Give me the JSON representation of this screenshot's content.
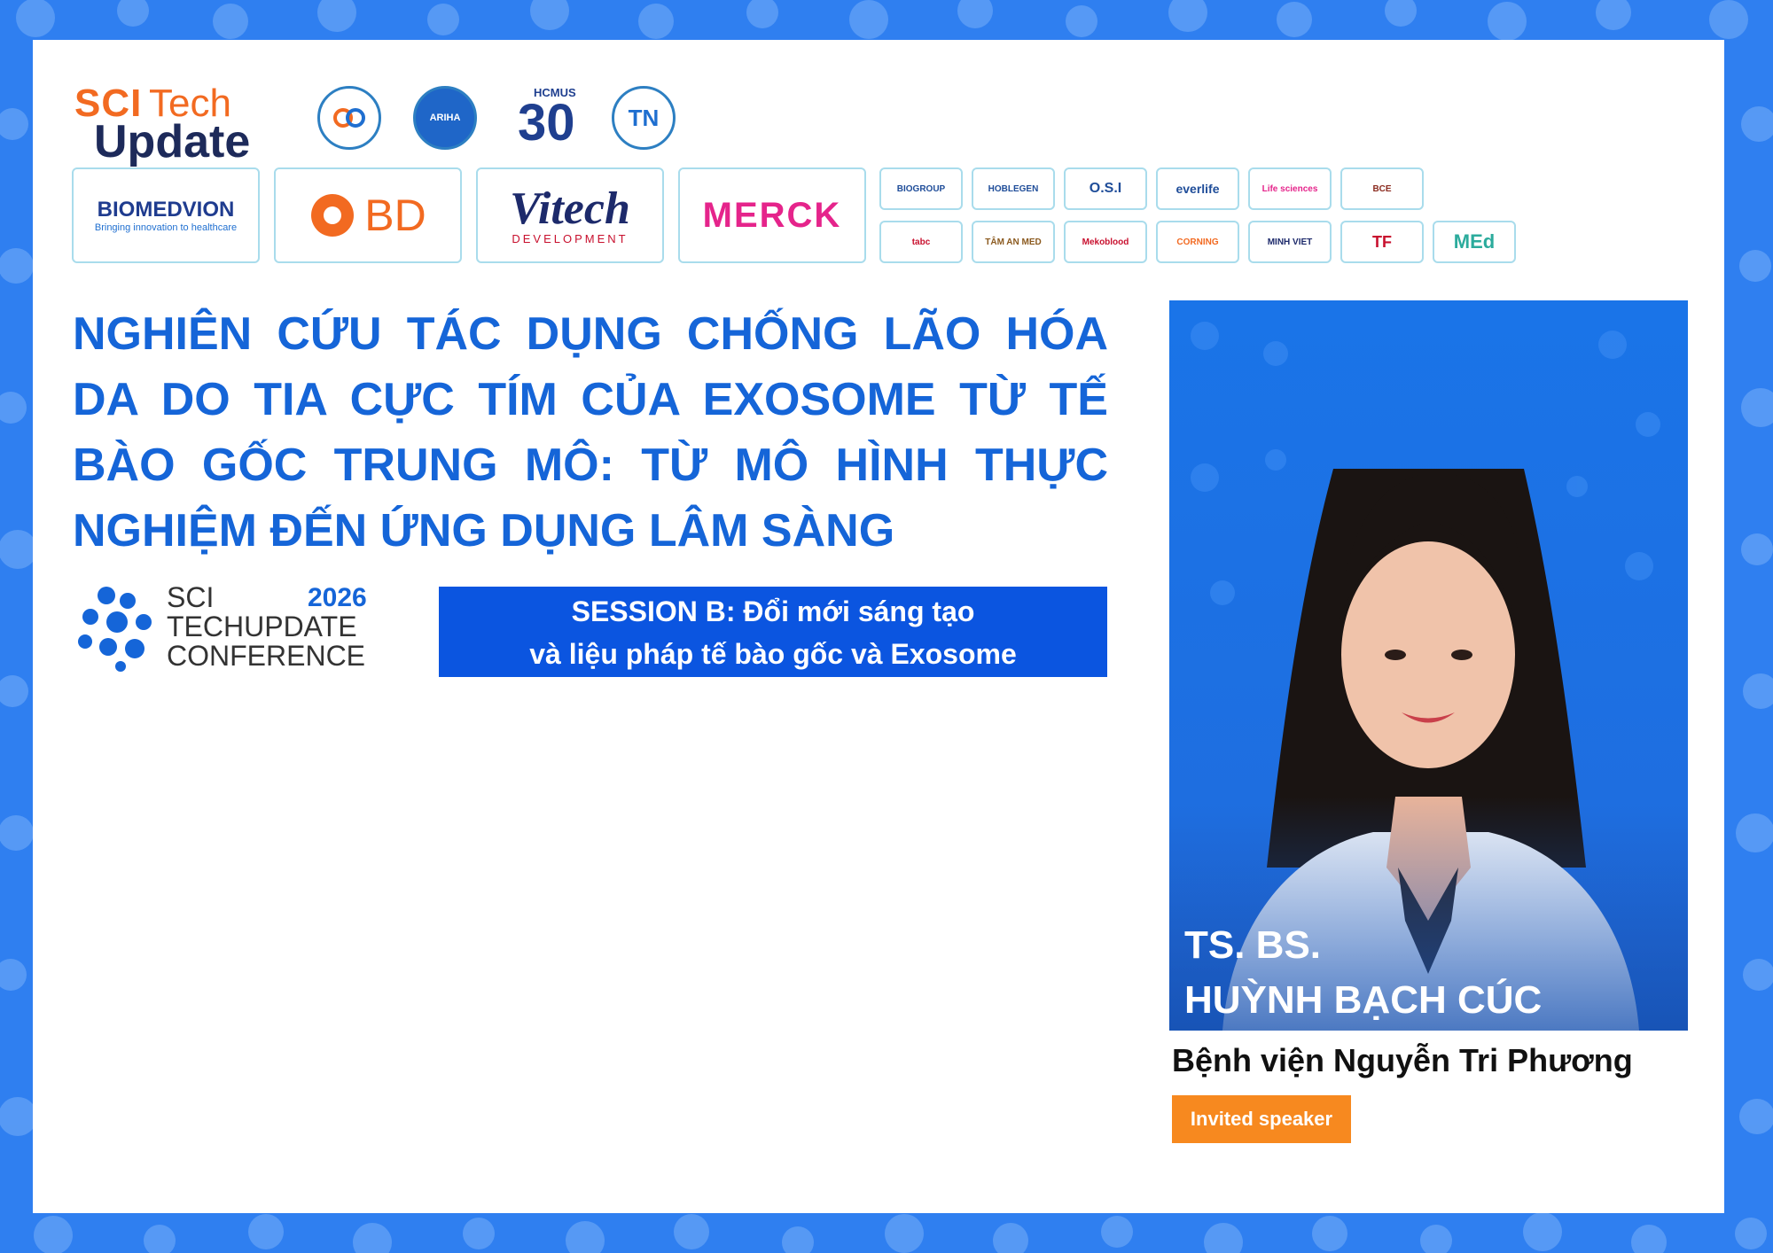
{
  "brand": {
    "sci": "SCI",
    "tech": "Tech",
    "update": "Update"
  },
  "org_logos": [
    {
      "icon": "institute-logo-icon",
      "label": ""
    },
    {
      "icon": "ariha-logo-icon",
      "label": "ARIHA"
    },
    {
      "icon": "hcmus-30-logo-icon",
      "label": "HCMUS",
      "number": "30"
    },
    {
      "icon": "tn-logo-icon",
      "label": "TN"
    }
  ],
  "sponsors_large": [
    {
      "name": "BIOMEDVION",
      "tagline": "Bringing innovation to healthcare",
      "color": "#1f3c8f"
    },
    {
      "name": "BD",
      "color": "#f26a21"
    },
    {
      "name": "Vitech",
      "tagline": "DEVELOPMENT",
      "color": "#1d2a6b"
    },
    {
      "name": "MERCK",
      "color": "#e5248b"
    }
  ],
  "sponsors_small_row1": [
    "BIOGROUP",
    "HOBLEGEN",
    "O.S.I",
    "everlife",
    "Life sciences",
    "BCE"
  ],
  "sponsors_small_row2": [
    "tabc",
    "TÂM AN MED",
    "Mekoblood",
    "CORNING",
    "MINH VIET",
    "TF",
    "MEd"
  ],
  "title": "NGHIÊN CỨU TÁC DỤNG CHỐNG LÃO HÓA DA DO TIA CỰC TÍM CỦA EXOSOME TỪ TẾ BÀO GỐC TRUNG MÔ: TỪ MÔ HÌNH THỰC NGHIỆM ĐẾN ỨNG DỤNG LÂM SÀNG",
  "conference": {
    "line1": "SCI",
    "line2": "TECHUPDATE",
    "line3": "CONFERENCE",
    "year": "2026"
  },
  "session": {
    "line1": "SESSION B: Đổi mới sáng tạo",
    "line2": "và liệu pháp tế bào gốc và Exosome"
  },
  "speaker": {
    "degree": "TS. BS.",
    "name": "HUỲNH BẠCH CÚC",
    "affiliation": "Bệnh viện Nguyễn Tri Phương",
    "role": "Invited speaker"
  },
  "colors": {
    "frame": "#2f7ff0",
    "title": "#1565d8",
    "session_bg": "#0b55e0",
    "role_bg": "#f7891f"
  }
}
